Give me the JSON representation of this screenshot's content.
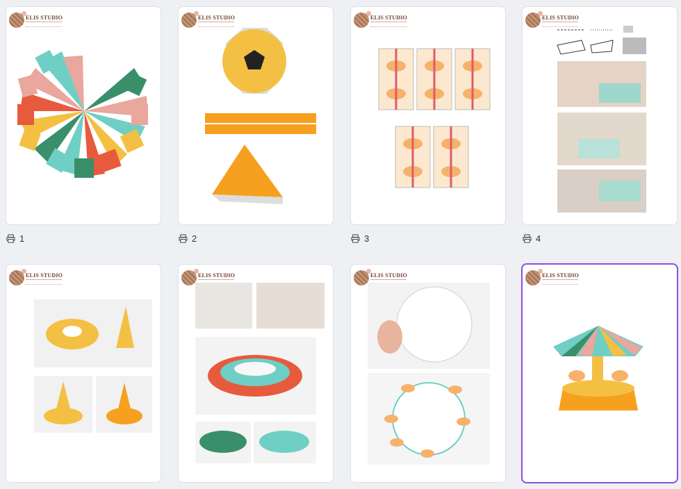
{
  "brand": {
    "logo_text": "ELIS STUDIO"
  },
  "pages": [
    {
      "number": "1",
      "selected": false
    },
    {
      "number": "2",
      "selected": false
    },
    {
      "number": "3",
      "selected": false
    },
    {
      "number": "4",
      "selected": false
    },
    {
      "number": "",
      "selected": false
    },
    {
      "number": "",
      "selected": false
    },
    {
      "number": "",
      "selected": false
    },
    {
      "number": "",
      "selected": true
    }
  ],
  "colors": {
    "selection_outline": "#8a4fe0",
    "teal": "#6fcfc4",
    "pink": "#e9a79e",
    "red": "#e85a3e",
    "yellow": "#f4c043",
    "orange": "#f6a01f",
    "green": "#3a8f6b"
  },
  "icons": {
    "page_label": "printer-icon"
  }
}
